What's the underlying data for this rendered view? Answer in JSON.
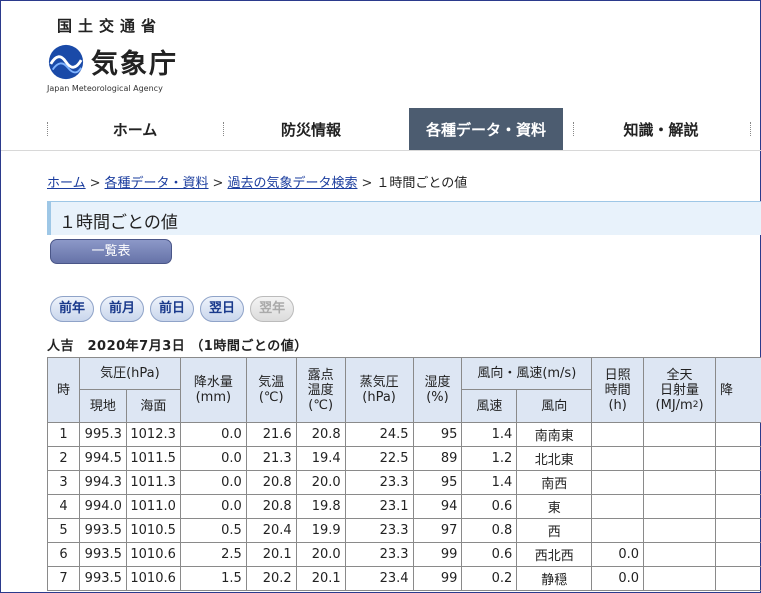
{
  "header": {
    "ministry": "国土交通省",
    "agency_name": "気象庁",
    "agency_name_en": "Japan Meteorological Agency"
  },
  "nav": {
    "items": [
      "ホーム",
      "防災情報",
      "各種データ・資料",
      "知識・解説"
    ],
    "active_index": 2
  },
  "breadcrumb": {
    "items": [
      "ホーム",
      "各種データ・資料",
      "過去の気象データ検索"
    ],
    "current": "１時間ごとの値",
    "separator": ">"
  },
  "page_title": "１時間ごとの値",
  "list_button": "一覧表",
  "day_buttons": [
    {
      "label": "前年",
      "enabled": true
    },
    {
      "label": "前月",
      "enabled": true
    },
    {
      "label": "前日",
      "enabled": true
    },
    {
      "label": "翌日",
      "enabled": true
    },
    {
      "label": "翌年",
      "enabled": false
    }
  ],
  "table_title": "人吉　2020年7月3日 （1時間ごとの値）",
  "table": {
    "headers": {
      "hour": "時",
      "pressure": "気圧(hPa)",
      "pressure_station": "現地",
      "pressure_sea": "海面",
      "precip": "降水量",
      "precip_unit": "(mm)",
      "temp": "気温",
      "temp_unit": "(℃)",
      "dew": "露点",
      "dew2": "温度",
      "dew_unit": "(℃)",
      "vapor": "蒸気圧",
      "vapor_unit": "(hPa)",
      "humidity": "湿度",
      "humidity_unit": "(%)",
      "wind": "風向・風速(m/s)",
      "wind_speed": "風速",
      "wind_dir": "風向",
      "sunshine": "日照",
      "sunshine2": "時間",
      "sunshine_unit": "(h)",
      "radiation": "全天",
      "radiation2": "日射量",
      "radiation_unit": "(MJ/m",
      "radiation_sup": "2",
      "radiation_close": ")",
      "next_col": "降"
    },
    "rows": [
      [
        "1",
        "995.3",
        "1012.3",
        "0.0",
        "21.6",
        "20.8",
        "24.5",
        "95",
        "1.4",
        "南南東",
        "",
        ""
      ],
      [
        "2",
        "994.5",
        "1011.5",
        "0.0",
        "21.3",
        "19.4",
        "22.5",
        "89",
        "1.2",
        "北北東",
        "",
        ""
      ],
      [
        "3",
        "994.3",
        "1011.3",
        "0.0",
        "20.8",
        "20.0",
        "23.3",
        "95",
        "1.4",
        "南西",
        "",
        ""
      ],
      [
        "4",
        "994.0",
        "1011.0",
        "0.0",
        "20.8",
        "19.8",
        "23.1",
        "94",
        "0.6",
        "東",
        "",
        ""
      ],
      [
        "5",
        "993.5",
        "1010.5",
        "0.5",
        "20.4",
        "19.9",
        "23.3",
        "97",
        "0.8",
        "西",
        "",
        ""
      ],
      [
        "6",
        "993.5",
        "1010.6",
        "2.5",
        "20.1",
        "20.0",
        "23.3",
        "99",
        "0.6",
        "西北西",
        "0.0",
        ""
      ],
      [
        "7",
        "993.5",
        "1010.6",
        "1.5",
        "20.2",
        "20.1",
        "23.4",
        "99",
        "0.2",
        "静穏",
        "0.0",
        ""
      ]
    ]
  }
}
